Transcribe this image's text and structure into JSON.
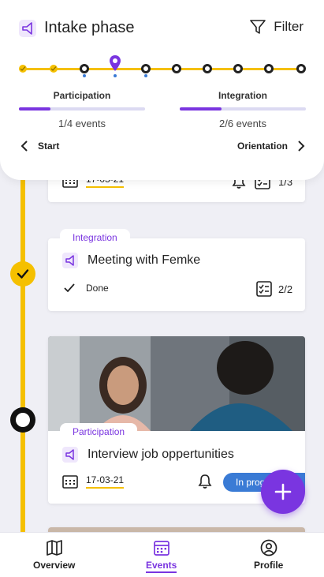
{
  "header": {
    "title": "Intake phase",
    "filter_label": "Filter",
    "phases": [
      {
        "label": "Participation",
        "count": "1/4 events",
        "progress": 0.25
      },
      {
        "label": "Integration",
        "count": "2/6 events",
        "progress": 0.33
      }
    ],
    "prev_label": "Start",
    "next_label": "Orientation"
  },
  "cards": {
    "top": {
      "date": "17-03-21",
      "count": "1/3"
    },
    "meeting": {
      "tag": "Integration",
      "title": "Meeting with Femke",
      "status": "Done",
      "count": "2/2"
    },
    "interview": {
      "tag": "Participation",
      "title": "Interview job oppertunities",
      "date": "17-03-21",
      "status": "In prog"
    }
  },
  "bottom_nav": {
    "items": [
      {
        "label": "Overview",
        "icon": "map-icon"
      },
      {
        "label": "Events",
        "icon": "calendar-icon"
      },
      {
        "label": "Profile",
        "icon": "profile-icon"
      }
    ],
    "active": "Events"
  },
  "colors": {
    "accent": "#7a35e0",
    "timeline": "#f5c000",
    "status_blue": "#3a7bd5"
  }
}
